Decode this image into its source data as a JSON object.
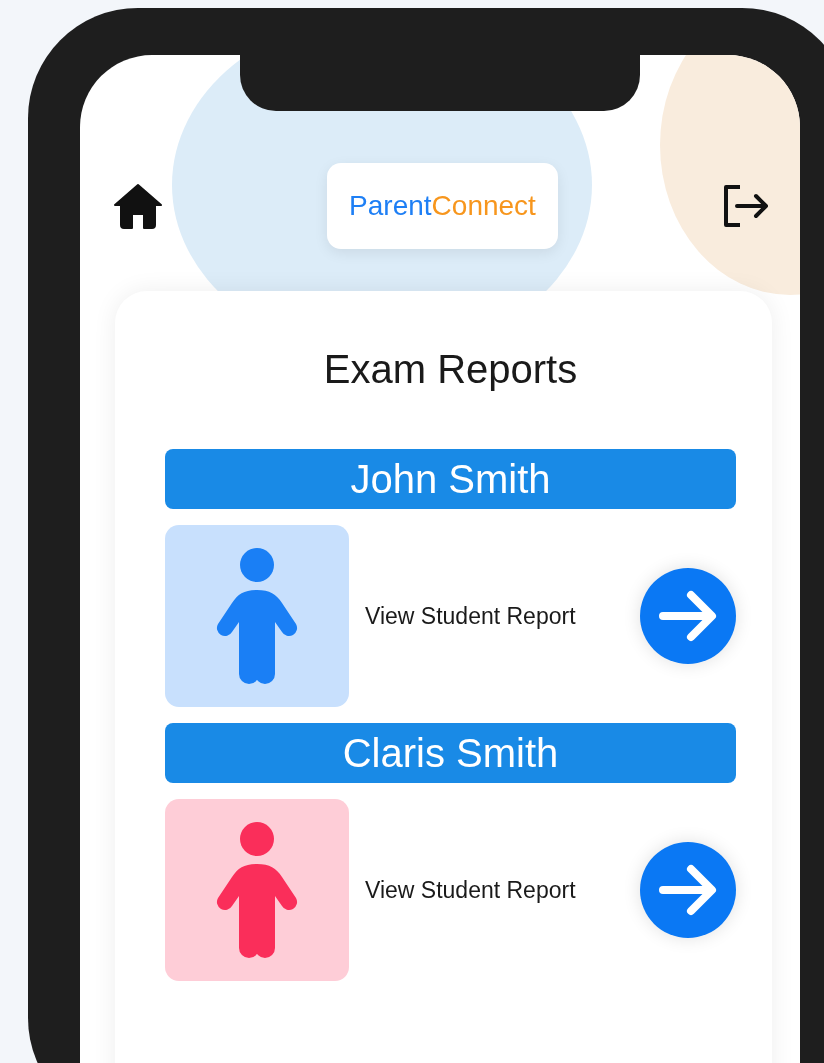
{
  "header": {
    "logo": {
      "part_1": "Parent",
      "part_2": "Connect"
    }
  },
  "page_title": "Exam Reports",
  "students": [
    {
      "name": "John Smith",
      "color": "#1a7ff5",
      "link": "View Student Report"
    },
    {
      "name": "Claris Smith",
      "color": "#fa2e5a",
      "link": "View Student Report"
    }
  ]
}
